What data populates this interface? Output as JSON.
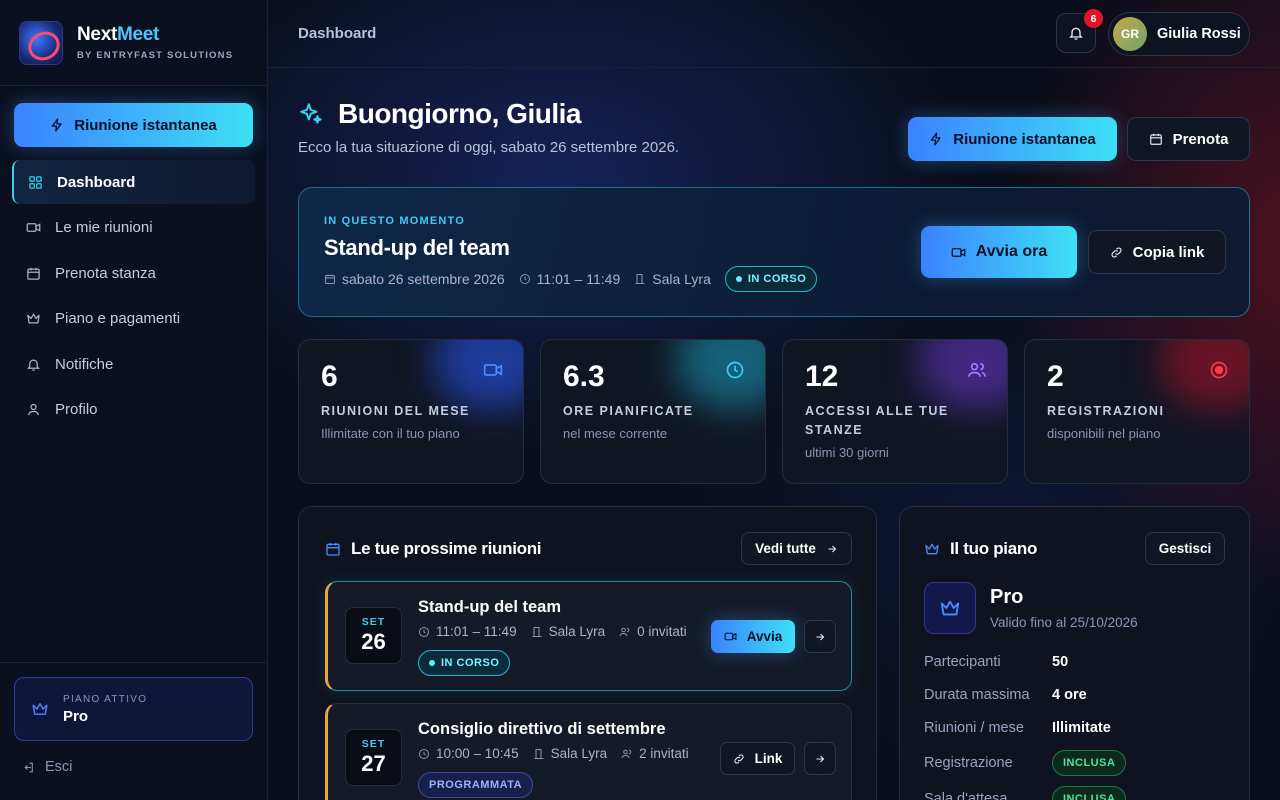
{
  "brand": {
    "name_a": "Next",
    "name_b": "Meet",
    "sub": "BY ENTRYFAST SOLUTIONS"
  },
  "sidebar": {
    "instant_label": "Riunione istantanea",
    "items": [
      {
        "label": "Dashboard",
        "icon": "grid-icon"
      },
      {
        "label": "Le mie riunioni",
        "icon": "video-icon"
      },
      {
        "label": "Prenota stanza",
        "icon": "calendar-icon"
      },
      {
        "label": "Piano e pagamenti",
        "icon": "crown-icon"
      },
      {
        "label": "Notifiche",
        "icon": "bell-icon"
      },
      {
        "label": "Profilo",
        "icon": "user-icon"
      }
    ],
    "plan_key": "PIANO ATTIVO",
    "plan_value": "Pro",
    "logout": "Esci"
  },
  "topbar": {
    "breadcrumb": "Dashboard",
    "notif_count": "6",
    "avatar_initials": "GR",
    "user_name": "Giulia Rossi"
  },
  "header": {
    "title": "Buongiorno, Giulia",
    "subtitle": "Ecco la tua situazione di oggi, sabato 26 settembre 2026.",
    "instant_label": "Riunione istantanea",
    "book_label": "Prenota"
  },
  "now": {
    "kicker": "IN QUESTO MOMENTO",
    "title": "Stand-up del team",
    "date": "sabato 26 settembre 2026",
    "time": "11:01 – 11:49",
    "room": "Sala Lyra",
    "status": "IN CORSO",
    "start_label": "Avvia ora",
    "copy_label": "Copia link"
  },
  "stats": [
    {
      "value": "6",
      "label": "RIUNIONI DEL MESE",
      "note": "Illimitate con il tuo piano",
      "icon": "video-icon",
      "color": "#3b82ff"
    },
    {
      "value": "6.3",
      "label": "ORE PIANIFICATE",
      "note": "nel mese corrente",
      "icon": "clock-icon",
      "color": "#3ad0f5"
    },
    {
      "value": "12",
      "label": "ACCESSI ALLE TUE STANZE",
      "note": "ultimi 30 giorni",
      "icon": "users-icon",
      "color": "#8b5cf6"
    },
    {
      "value": "2",
      "label": "REGISTRAZIONI",
      "note": "disponibili nel piano",
      "icon": "record-icon",
      "color": "#e0152a"
    }
  ],
  "meetings": {
    "title": "Le tue prossime riunioni",
    "see_all": "Vedi tutte",
    "items": [
      {
        "month": "SET",
        "day": "26",
        "title": "Stand-up del team",
        "time": "11:01 – 11:49",
        "room": "Sala Lyra",
        "invited": "0 invitati",
        "status": "IN CORSO",
        "action": "Avvia"
      },
      {
        "month": "SET",
        "day": "27",
        "title": "Consiglio direttivo di settembre",
        "time": "10:00 – 10:45",
        "room": "Sala Lyra",
        "invited": "2 invitati",
        "status": "PROGRAMMATA",
        "action": "Link"
      }
    ]
  },
  "plan": {
    "title": "Il tuo piano",
    "manage": "Gestisci",
    "name": "Pro",
    "valid": "Valido fino al 25/10/2026",
    "rows": [
      {
        "k": "Partecipanti",
        "v": "50"
      },
      {
        "k": "Durata massima",
        "v": "4 ore"
      },
      {
        "k": "Riunioni / mese",
        "v": "Illimitate"
      },
      {
        "k": "Registrazione",
        "v": "INCLUSA"
      },
      {
        "k": "Sala d'attesa",
        "v": "INCLUSA"
      }
    ]
  }
}
